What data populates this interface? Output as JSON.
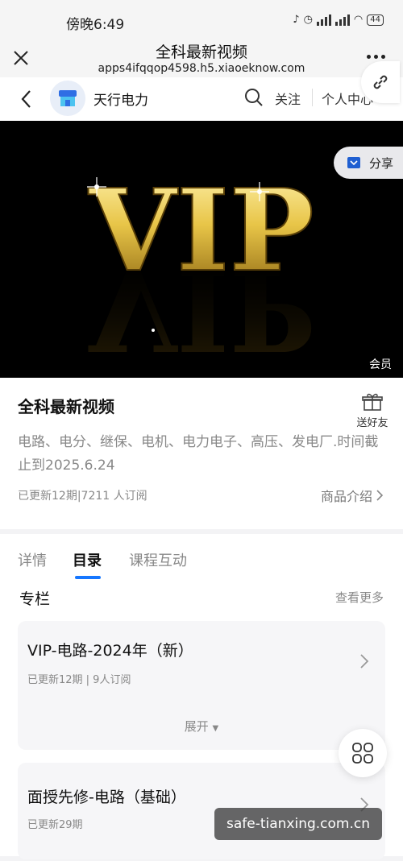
{
  "status_bar": {
    "time": "傍晚6:49",
    "battery": "44"
  },
  "title_bar": {
    "title": "全科最新视频",
    "url": "apps4ifqqop4598.h5.xiaoeknow.com"
  },
  "shop_bar": {
    "name": "天行电力",
    "follow": "关注",
    "personal": "个人中心"
  },
  "banner": {
    "art_text": "VIP",
    "share": "分享",
    "member_tag": "会员"
  },
  "product": {
    "title": "全科最新视频",
    "gift": "送好友",
    "description": "电路、电分、继保、电机、电力电子、高压、发电厂.时间截止到2025.6.24",
    "update_info": "已更新12期|7211 人订阅",
    "intro_link": "商品介绍"
  },
  "tabs": [
    {
      "label": "详情",
      "active": false
    },
    {
      "label": "目录",
      "active": true
    },
    {
      "label": "课程互动",
      "active": false
    }
  ],
  "section": {
    "title": "专栏",
    "see_more": "查看更多"
  },
  "courses": [
    {
      "name": "VIP-电路-2024年（新）",
      "meta": "已更新12期 | 9人订阅"
    },
    {
      "name": "面授先修-电路（基础）",
      "meta": "已更新29期"
    }
  ],
  "expand_label": "展开",
  "watermark": "safe-tianxing.com.cn",
  "colors": {
    "accent": "#1677ff",
    "vip_gold": "#e8c548"
  }
}
